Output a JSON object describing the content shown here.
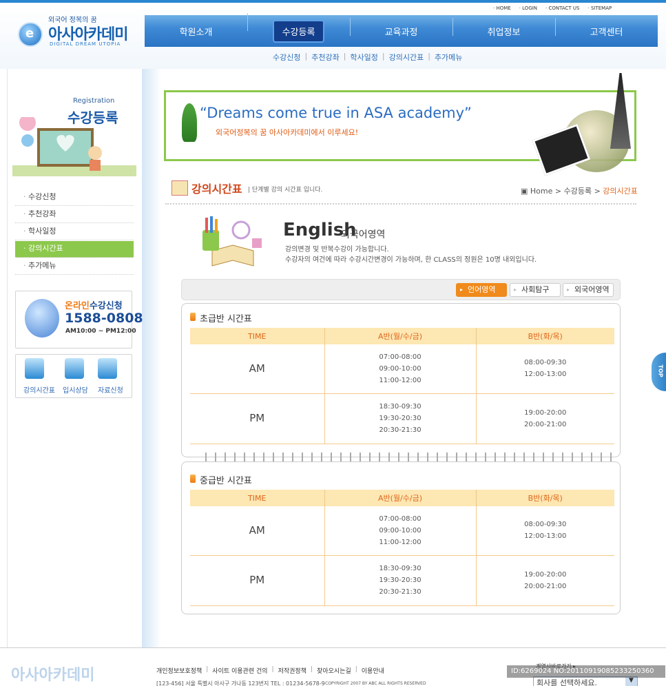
{
  "header": {
    "logo_sub": "외국어 정복의 꿈",
    "logo_title": "아사아카데미",
    "logo_en": "DIGITAL DREAM UTOPIA",
    "util_links": [
      "HOME",
      "LOGIN",
      "CONTACT US",
      "SITEMAP"
    ],
    "gnb": [
      "학원소개",
      "수강등록",
      "교육과정",
      "취업정보",
      "고객센터"
    ],
    "subnav": [
      "수강신청",
      "추천강좌",
      "학사일정",
      "강의시간표",
      "추가메뉴"
    ]
  },
  "sidebar": {
    "reg_en": "Registration",
    "reg_ko": "수강등록",
    "menu": [
      "수강신청",
      "추천강좌",
      "학사일정",
      "강의시간표",
      "추가메뉴"
    ],
    "online_title_a": "온라인",
    "online_title_b": "수강신청",
    "online_phone": "1588-0808",
    "online_hours": "AM10:00 ~ PM12:00",
    "quick": [
      "강의시간표",
      "입시상담",
      "자료신청"
    ]
  },
  "banner": {
    "quote": "“Dreams come true in ASA academy”",
    "kr": "외국어정복의 꿈 아사아카데미에서 이루세요!"
  },
  "section": {
    "title": "강의시간표",
    "desc": "| 단계별 강의 시간표 입니다.",
    "crumb_home": "Home",
    "crumb_mid": "수강등록",
    "crumb_current": "강의시간표"
  },
  "english": {
    "title": "English",
    "subtitle": "외국어영역",
    "desc1": "강의변경 및 반복수강이 가능합니다.",
    "desc2": "수강자의 여건에 따라 수강시간변경이 가능하며, 한 CLASS의 정원은 10명 내외입니다."
  },
  "tabs": [
    "언어영역",
    "사회탐구",
    "외국어영역"
  ],
  "timetables": [
    {
      "title": "초급반 시간표",
      "headers": [
        "TIME",
        "A반(월/수/금)",
        "B반(화/목)"
      ],
      "rows": [
        [
          "AM",
          "07:00-08:00\n09:00-10:00\n11:00-12:00",
          "08:00-09:30\n12:00-13:00"
        ],
        [
          "PM",
          "18:30-09:30\n19:30-20:30\n20:30-21:30",
          "19:00-20:00\n20:00-21:00"
        ]
      ]
    },
    {
      "title": "중급반 시간표",
      "headers": [
        "TIME",
        "A반(월/수/금)",
        "B반(화/목)"
      ],
      "rows": [
        [
          "AM",
          "07:00-08:00\n09:00-10:00\n11:00-12:00",
          "08:00-09:30\n12:00-13:00"
        ],
        [
          "PM",
          "18:30-09:30\n19:30-20:30\n20:30-21:30",
          "19:00-20:00\n20:00-21:00"
        ]
      ]
    }
  ],
  "top_button": "TOP",
  "footer": {
    "links": [
      "개인정보보호정책",
      "사이트 이용관련 건의",
      "저작권정책",
      "찾아오시는길",
      "이용안내"
    ],
    "address": "[123-456] 서울 특별시 아사구 가나동 123번지 TEL : 01234-5678-9",
    "copyright": "COPYRIGHT 2007 BY ABC ALL RIGHTS RESERVED",
    "family_label": "계열사바로가기 ▸",
    "family_select": "회사를 선택하세요.",
    "id_text": "ID:6269024 NO:20110919085233250360"
  }
}
